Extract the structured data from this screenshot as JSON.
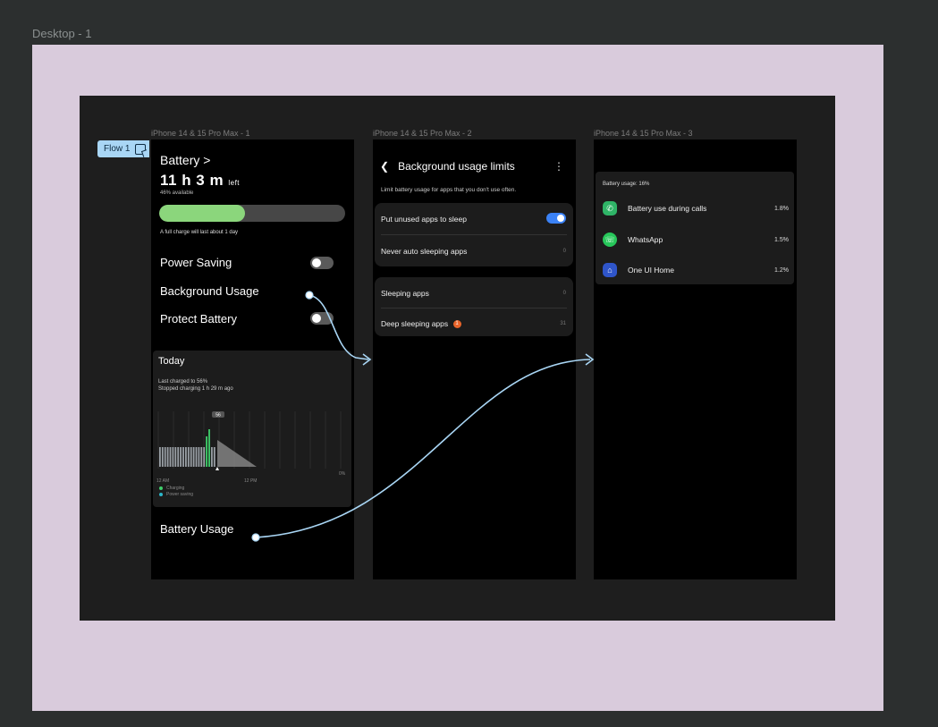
{
  "canvas": {
    "frame_title": "Desktop - 1",
    "flow_label": "Flow 1",
    "frame_names": [
      "iPhone 14 & 15 Pro Max - 1",
      "iPhone 14 & 15 Pro Max - 2",
      "iPhone 14 & 15 Pro Max - 3"
    ]
  },
  "screen1": {
    "title": "Battery >",
    "time_value": "11 h 3 m",
    "time_suffix": "left",
    "available": "46% available",
    "battery_level": 0.46,
    "charge_note": "A full charge will last about 1 day",
    "power_saving": "Power Saving",
    "background_usage": "Background Usage",
    "protect_battery": "Protect Battery",
    "today": {
      "title": "Today",
      "last_charged": "Last charged to 56%",
      "stopped": "Stopped charging 1 h 29 m ago",
      "marker": "56",
      "x_start": "12 AM",
      "x_mid": "12 PM",
      "y_min": "0%",
      "legend_charging": "Charging",
      "legend_power_saving": "Power saving"
    },
    "battery_usage": "Battery Usage"
  },
  "screen2": {
    "title": "Background usage limits",
    "description": "Limit battery usage for apps that you don't use often.",
    "put_unused": "Put unused apps to sleep",
    "never_auto": "Never auto sleeping apps",
    "never_auto_count": "0",
    "sleeping": "Sleeping apps",
    "sleeping_count": "0",
    "deep_sleeping": "Deep sleeping apps",
    "deep_sleeping_badge": "1",
    "deep_sleeping_count": "31"
  },
  "screen3": {
    "header": "Battery usage: 16%",
    "apps": [
      {
        "name": "Battery use during calls",
        "pct": "1.8%",
        "icon": "phone-icon",
        "color": "#2fb467"
      },
      {
        "name": "WhatsApp",
        "pct": "1.5%",
        "icon": "whatsapp-icon",
        "color": "#27c65a"
      },
      {
        "name": "One UI Home",
        "pct": "1.2%",
        "icon": "home-icon",
        "color": "#2f55c9"
      }
    ]
  },
  "colors": {
    "battery_fill": "#8bd67c",
    "toggle_on": "#3b82f6",
    "flow_line": "#a9d6f5",
    "desktop_bg": "#d9cbdc"
  }
}
